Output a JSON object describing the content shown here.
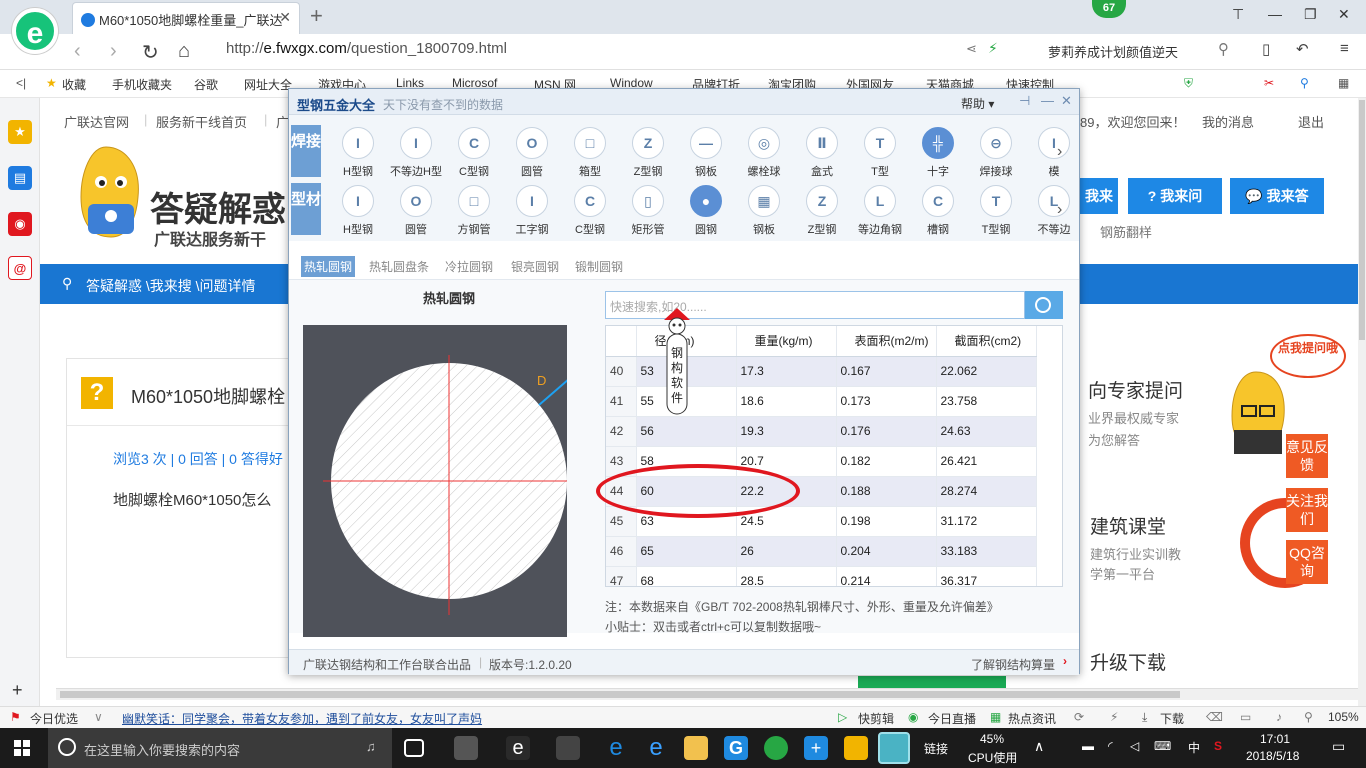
{
  "browser": {
    "tab_title": "M60*1050地脚螺栓重量_广联达",
    "url_domain": "e.fwxgx.com",
    "url_path": "/question_1800709.html",
    "url_scheme": "http://",
    "badge": "67",
    "address_right_text": "萝莉养成计划颜值逆天",
    "favorites": [
      "收藏",
      "手机收藏夹",
      "谷歌",
      "网址大全",
      "游戏中心",
      "Links",
      "Microsof",
      "MSN 网",
      "Window",
      "品牌打折",
      "淘宝团购",
      "外国网友",
      "天猫商城",
      "快速控制"
    ]
  },
  "site": {
    "topnav": [
      "广联达官网",
      "服务新干线首页",
      "广"
    ],
    "topnav_right": [
      "89，欢迎您回来！",
      "我的消息",
      "退出"
    ],
    "logo_text": "答疑解惑",
    "logo_sub": "广联达服务新干",
    "breadcrumb": "答疑解惑 \\我来搜 \\问题详情",
    "buttons": [
      "我来搜",
      "我来问",
      "我来答"
    ],
    "steel_link": "钢筋翻样",
    "question_title": "M60*1050地脚螺栓",
    "question_meta": "浏览3 次 | 0 回答 | 0 答得好",
    "question_body": "地脚螺栓M60*1050怎么",
    "right": [
      {
        "title": "向专家提问",
        "desc1": "业界最权威专家",
        "desc2": "为您解答"
      },
      {
        "title": "建筑课堂",
        "desc1": "建筑行业实训教",
        "desc2": "学第一平台"
      },
      {
        "title": "升级下载",
        "desc1": "",
        "desc2": ""
      }
    ],
    "click_me": "点我提问哦",
    "side_buttons": [
      "意见反馈",
      "关注我们",
      "QQ咨询"
    ]
  },
  "dialog": {
    "title": "型钢五金大全",
    "subtitle": "天下没有查不到的数据",
    "help": "帮助",
    "cat1": "焊接",
    "cat2": "型材",
    "row1": [
      {
        "label": "H型钢",
        "icon": "I"
      },
      {
        "label": "不等边H型",
        "icon": "I"
      },
      {
        "label": "C型钢",
        "icon": "C"
      },
      {
        "label": "圆管",
        "icon": "O"
      },
      {
        "label": "箱型",
        "icon": "□"
      },
      {
        "label": "Z型钢",
        "icon": "Z"
      },
      {
        "label": "钢板",
        "icon": "—"
      },
      {
        "label": "螺栓球",
        "icon": "◎"
      },
      {
        "label": "盒式",
        "icon": "Ⅱ"
      },
      {
        "label": "T型",
        "icon": "T"
      },
      {
        "label": "十字",
        "icon": "╬"
      },
      {
        "label": "焊接球",
        "icon": "⊖"
      },
      {
        "label": "模",
        "icon": "I"
      }
    ],
    "row2": [
      {
        "label": "H型钢",
        "icon": "I"
      },
      {
        "label": "圆管",
        "icon": "O"
      },
      {
        "label": "方钢管",
        "icon": "□"
      },
      {
        "label": "工字钢",
        "icon": "I"
      },
      {
        "label": "C型钢",
        "icon": "C"
      },
      {
        "label": "矩形管",
        "icon": "▯"
      },
      {
        "label": "圆钢",
        "icon": "●"
      },
      {
        "label": "钢板",
        "icon": "▦"
      },
      {
        "label": "Z型钢",
        "icon": "Z"
      },
      {
        "label": "等边角钢",
        "icon": "L"
      },
      {
        "label": "槽钢",
        "icon": "C"
      },
      {
        "label": "T型钢",
        "icon": "T"
      },
      {
        "label": "不等边",
        "icon": "L"
      }
    ],
    "subtabs": [
      "热轧圆钢",
      "热轧圆盘条",
      "冷拉圆钢",
      "银亮圆钢",
      "锻制圆钢"
    ],
    "section_title": "热轧圆钢",
    "search_placeholder": "快速搜索,如20......",
    "headers": [
      "径(mm)",
      "重量(kg/m)",
      "表面积(m2/m)",
      "截面积(cm2)"
    ],
    "rows": [
      [
        "40",
        "53",
        "17.3",
        "0.167",
        "22.062"
      ],
      [
        "41",
        "55",
        "18.6",
        "0.173",
        "23.758"
      ],
      [
        "42",
        "56",
        "19.3",
        "0.176",
        "24.63"
      ],
      [
        "43",
        "58",
        "20.7",
        "0.182",
        "26.421"
      ],
      [
        "44",
        "60",
        "22.2",
        "0.188",
        "28.274"
      ],
      [
        "45",
        "63",
        "24.5",
        "0.198",
        "31.172"
      ],
      [
        "46",
        "65",
        "26",
        "0.204",
        "33.183"
      ],
      [
        "47",
        "68",
        "28.5",
        "0.214",
        "36.317"
      ]
    ],
    "mascot_text": "钢构软件",
    "dim_label": "D",
    "note1": "注：本数据来自《GB/T 702-2008热轧钢棒尺寸、外形、重量及允许偏差》",
    "note2": "小贴士：双击或者ctrl+c可以复制数据哦~",
    "footer_left": "广联达钢结构和工作台联合出品",
    "version": "版本号:1.2.0.20",
    "footer_right": "了解钢结构算量"
  },
  "statusbar": {
    "left": "今日优选",
    "news": "幽默笑话：同学聚会，带着女友参加，遇到了前女友，女友叫了声妈",
    "items": [
      "快剪辑",
      "今日直播",
      "热点资讯",
      "下载"
    ],
    "zoom": "105%"
  },
  "taskbar": {
    "search_placeholder": "在这里输入你要搜索的内容",
    "link": "链接",
    "cpu_percent": "45%",
    "cpu_label": "CPU使用",
    "time": "17:01",
    "date": "2018/5/18",
    "ime": "中"
  },
  "colors": {
    "accent": "#1976d2",
    "highlight_ring": "#e0171f",
    "dialog_header": "#e7eef6"
  }
}
